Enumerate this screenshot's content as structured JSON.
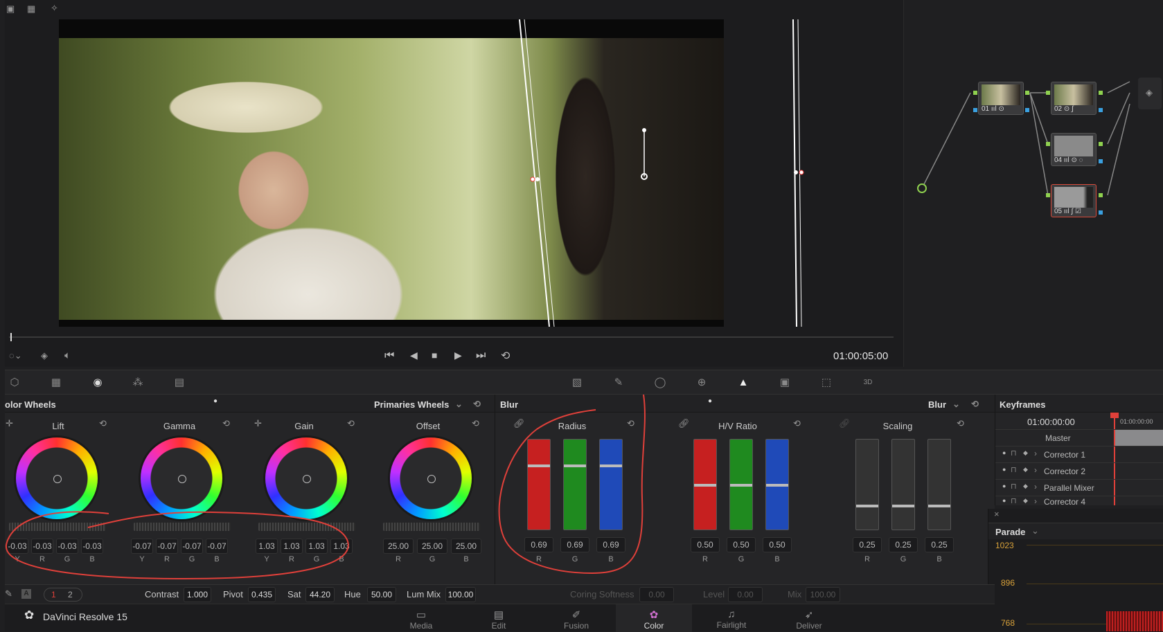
{
  "viewer": {
    "timecode": "01:00:05:00"
  },
  "nodes": [
    {
      "label": "01 ııl ⊙"
    },
    {
      "label": "02 ⊙ ∫"
    },
    {
      "label": "04 ııl ⊙ ◌"
    },
    {
      "label": "05 ııl ∫ ☑"
    }
  ],
  "color_wheels": {
    "title": "olor Wheels",
    "mode": "Primaries Wheels",
    "wheels": [
      {
        "name": "Lift",
        "values": [
          "-0.03",
          "-0.03",
          "-0.03",
          "-0.03"
        ],
        "channels": [
          "Y",
          "R",
          "G",
          "B"
        ]
      },
      {
        "name": "Gamma",
        "values": [
          "-0.07",
          "-0.07",
          "-0.07",
          "-0.07"
        ],
        "channels": [
          "Y",
          "R",
          "G",
          "B"
        ]
      },
      {
        "name": "Gain",
        "values": [
          "1.03",
          "1.03",
          "1.03",
          "1.03"
        ],
        "channels": [
          "Y",
          "R",
          "G",
          "B"
        ]
      },
      {
        "name": "Offset",
        "values": [
          "25.00",
          "25.00",
          "25.00"
        ],
        "channels": [
          "R",
          "G",
          "B"
        ]
      }
    ],
    "bottom": {
      "page1": "1",
      "page2": "2",
      "contrast_label": "Contrast",
      "contrast": "1.000",
      "pivot_label": "Pivot",
      "pivot": "0.435",
      "sat_label": "Sat",
      "sat": "44.20",
      "hue_label": "Hue",
      "hue": "50.00",
      "lummix_label": "Lum Mix",
      "lummix": "100.00"
    }
  },
  "blur": {
    "title": "Blur",
    "mode": "Blur",
    "groups": [
      {
        "name": "Radius",
        "values": [
          "0.69",
          "0.69",
          "0.69"
        ]
      },
      {
        "name": "H/V Ratio",
        "values": [
          "0.50",
          "0.50",
          "0.50"
        ]
      },
      {
        "name": "Scaling",
        "values": [
          "0.25",
          "0.25",
          "0.25"
        ]
      }
    ],
    "channels": [
      "R",
      "G",
      "B"
    ],
    "bottom": {
      "coring_label": "Coring Softness",
      "coring": "0.00",
      "level_label": "Level",
      "level": "0.00",
      "mix_label": "Mix",
      "mix": "100.00"
    }
  },
  "keyframes": {
    "title": "Keyframes",
    "timecode": "01:00:00:00",
    "ruler": "01:00:00:00",
    "master": "Master",
    "rows": [
      "Corrector 1",
      "Corrector 2",
      "Parallel Mixer",
      "Corrector 4"
    ]
  },
  "scope": {
    "title": "Parade",
    "ticks": [
      "1023",
      "896",
      "768"
    ]
  },
  "app": {
    "name": "DaVinci Resolve 15"
  },
  "pages": [
    "Media",
    "Edit",
    "Fusion",
    "Color",
    "Fairlight",
    "Deliver"
  ],
  "colors": {
    "accent": "#e0403a",
    "red_bar": "#c62020",
    "green_bar": "#1f8a1f",
    "blue_bar": "#1f4ab8"
  }
}
